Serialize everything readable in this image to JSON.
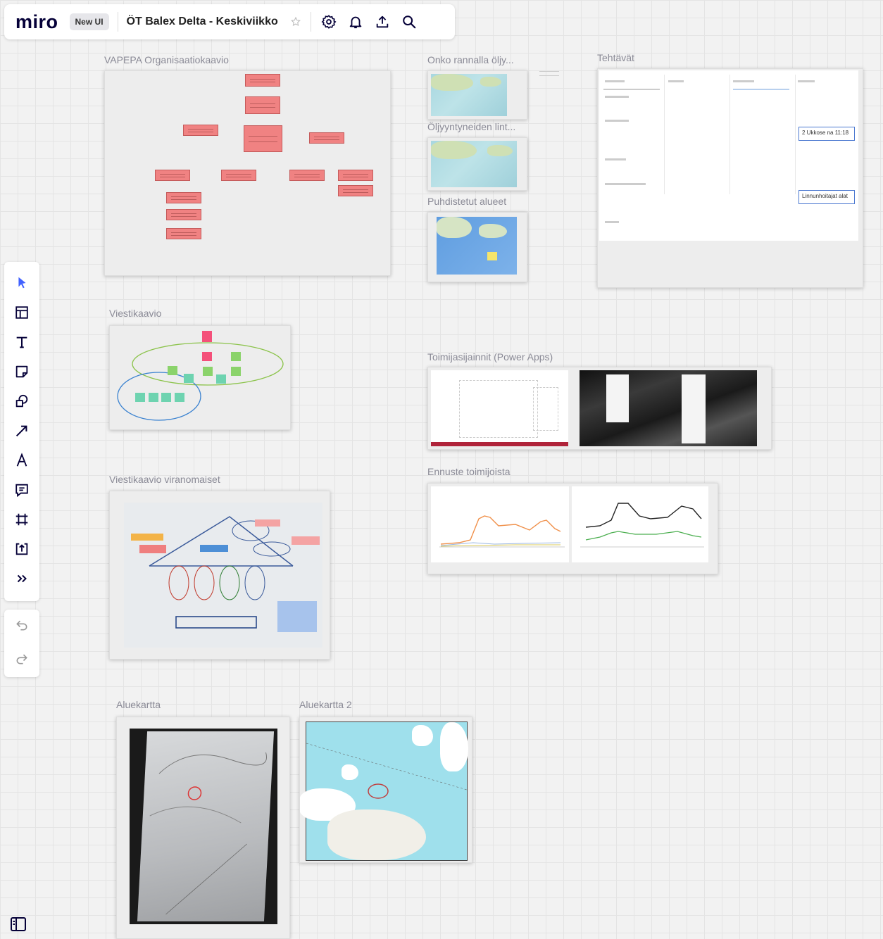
{
  "app": {
    "logo": "miro",
    "badge": "New UI",
    "board_title": "ÖT Balex Delta - Keskiviikko"
  },
  "topbar_icons": [
    "star-icon",
    "settings-icon",
    "bell-icon",
    "share-upload-icon",
    "search-icon"
  ],
  "toolbar": [
    "select-cursor-icon",
    "templates-icon",
    "text-icon",
    "sticky-note-icon",
    "shapes-icon",
    "arrow-line-icon",
    "pen-icon",
    "comment-icon",
    "frame-icon",
    "upload-icon",
    "more-tools-icon"
  ],
  "frames": {
    "org_chart": "VAPEPA Organisaatiokaavio",
    "map1": "Onko rannalla öljy...",
    "map2": "Öljyyntyneiden lint...",
    "map3": "Puhdistetut alueet",
    "tasks": "Tehtävät",
    "comm_chart": "Viestikaavio",
    "supplier_locations": "Toimijasijainnit (Power Apps)",
    "comm_authorities": "Viestikaavio viranomaiset",
    "forecast": "Ennuste toimijoista",
    "area_map": "Aluekartta",
    "area_map2": "Aluekartta 2"
  },
  "tasks_board": {
    "cards": [
      "2 Ukkose na 11:18",
      "Linnunhoitajat alat"
    ]
  },
  "colors": {
    "org_box": "#f08282",
    "forecast_orange": "#f0904a",
    "forecast_green": "#4caf50",
    "accent_blue": "#4262ff"
  }
}
